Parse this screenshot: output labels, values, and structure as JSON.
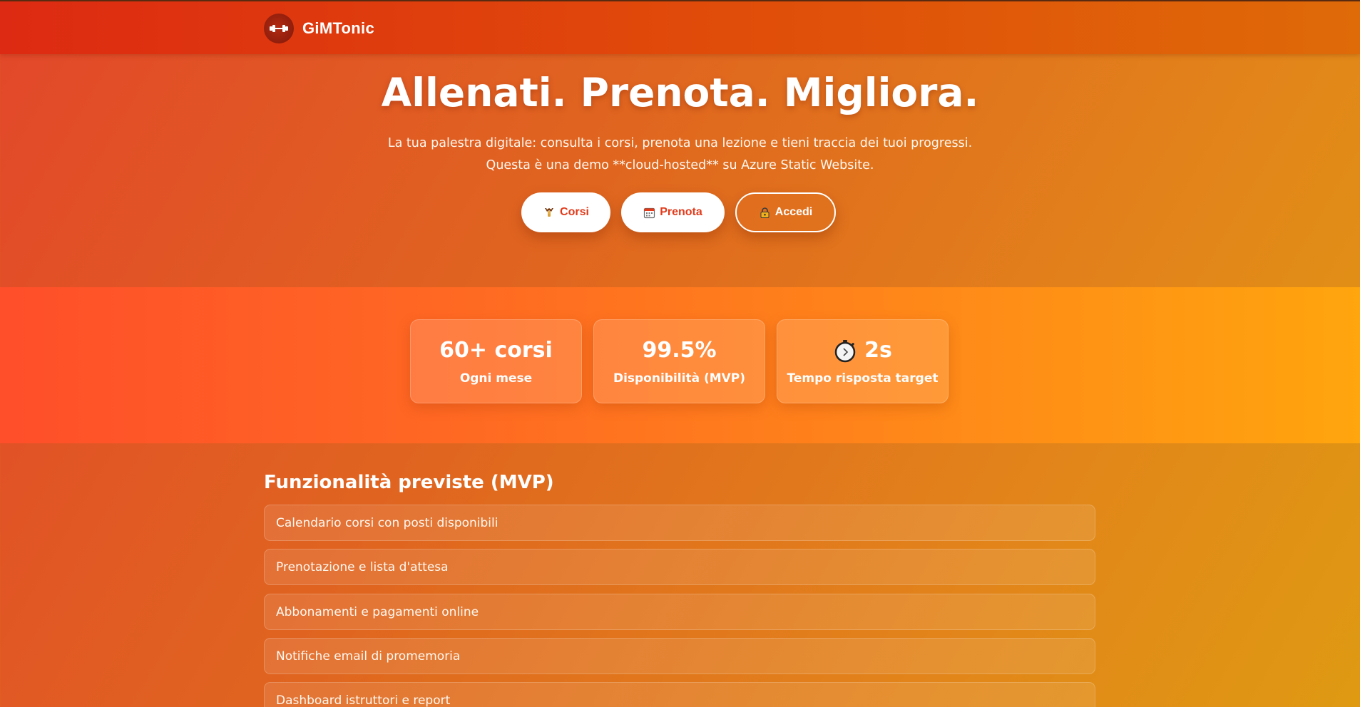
{
  "header": {
    "brand_name": "GiMTonic",
    "logo_icon": "dumbbell-icon"
  },
  "hero": {
    "title": "Allenati. Prenota. Migliora.",
    "subtitle_line1": "La tua palestra digitale: consulta i corsi, prenota una lezione e tieni traccia dei tuoi progressi.",
    "subtitle_line2": "Questa è una demo **cloud-hosted** su Azure Static Website.",
    "buttons": [
      {
        "label": "Corsi",
        "icon": "flexed-arm-icon"
      },
      {
        "label": "Prenota",
        "icon": "calendar-icon"
      },
      {
        "label": "Accedi",
        "icon": "lock-icon"
      }
    ]
  },
  "stats": [
    {
      "value": "60+ corsi",
      "label": "Ogni mese"
    },
    {
      "value": "99.5%",
      "label": "Disponibilità (MVP)"
    },
    {
      "value": "2s",
      "label": "Tempo risposta target",
      "icon": "stopwatch-icon"
    }
  ],
  "features": {
    "title": "Funzionalità previste (MVP)",
    "items": [
      "Calendario corsi con posti disponibili",
      "Prenotazione e lista d'attesa",
      "Abbonamenti e pagamenti online",
      "Notifiche email di promemoria",
      "Dashboard istruttori e report"
    ]
  },
  "colors": {
    "header_start": "#dd2a12",
    "header_end": "#df6a08",
    "button_text": "#e23a1a",
    "stats_band_start": "#ff4e2a",
    "stats_band_end": "#ffa50d"
  }
}
